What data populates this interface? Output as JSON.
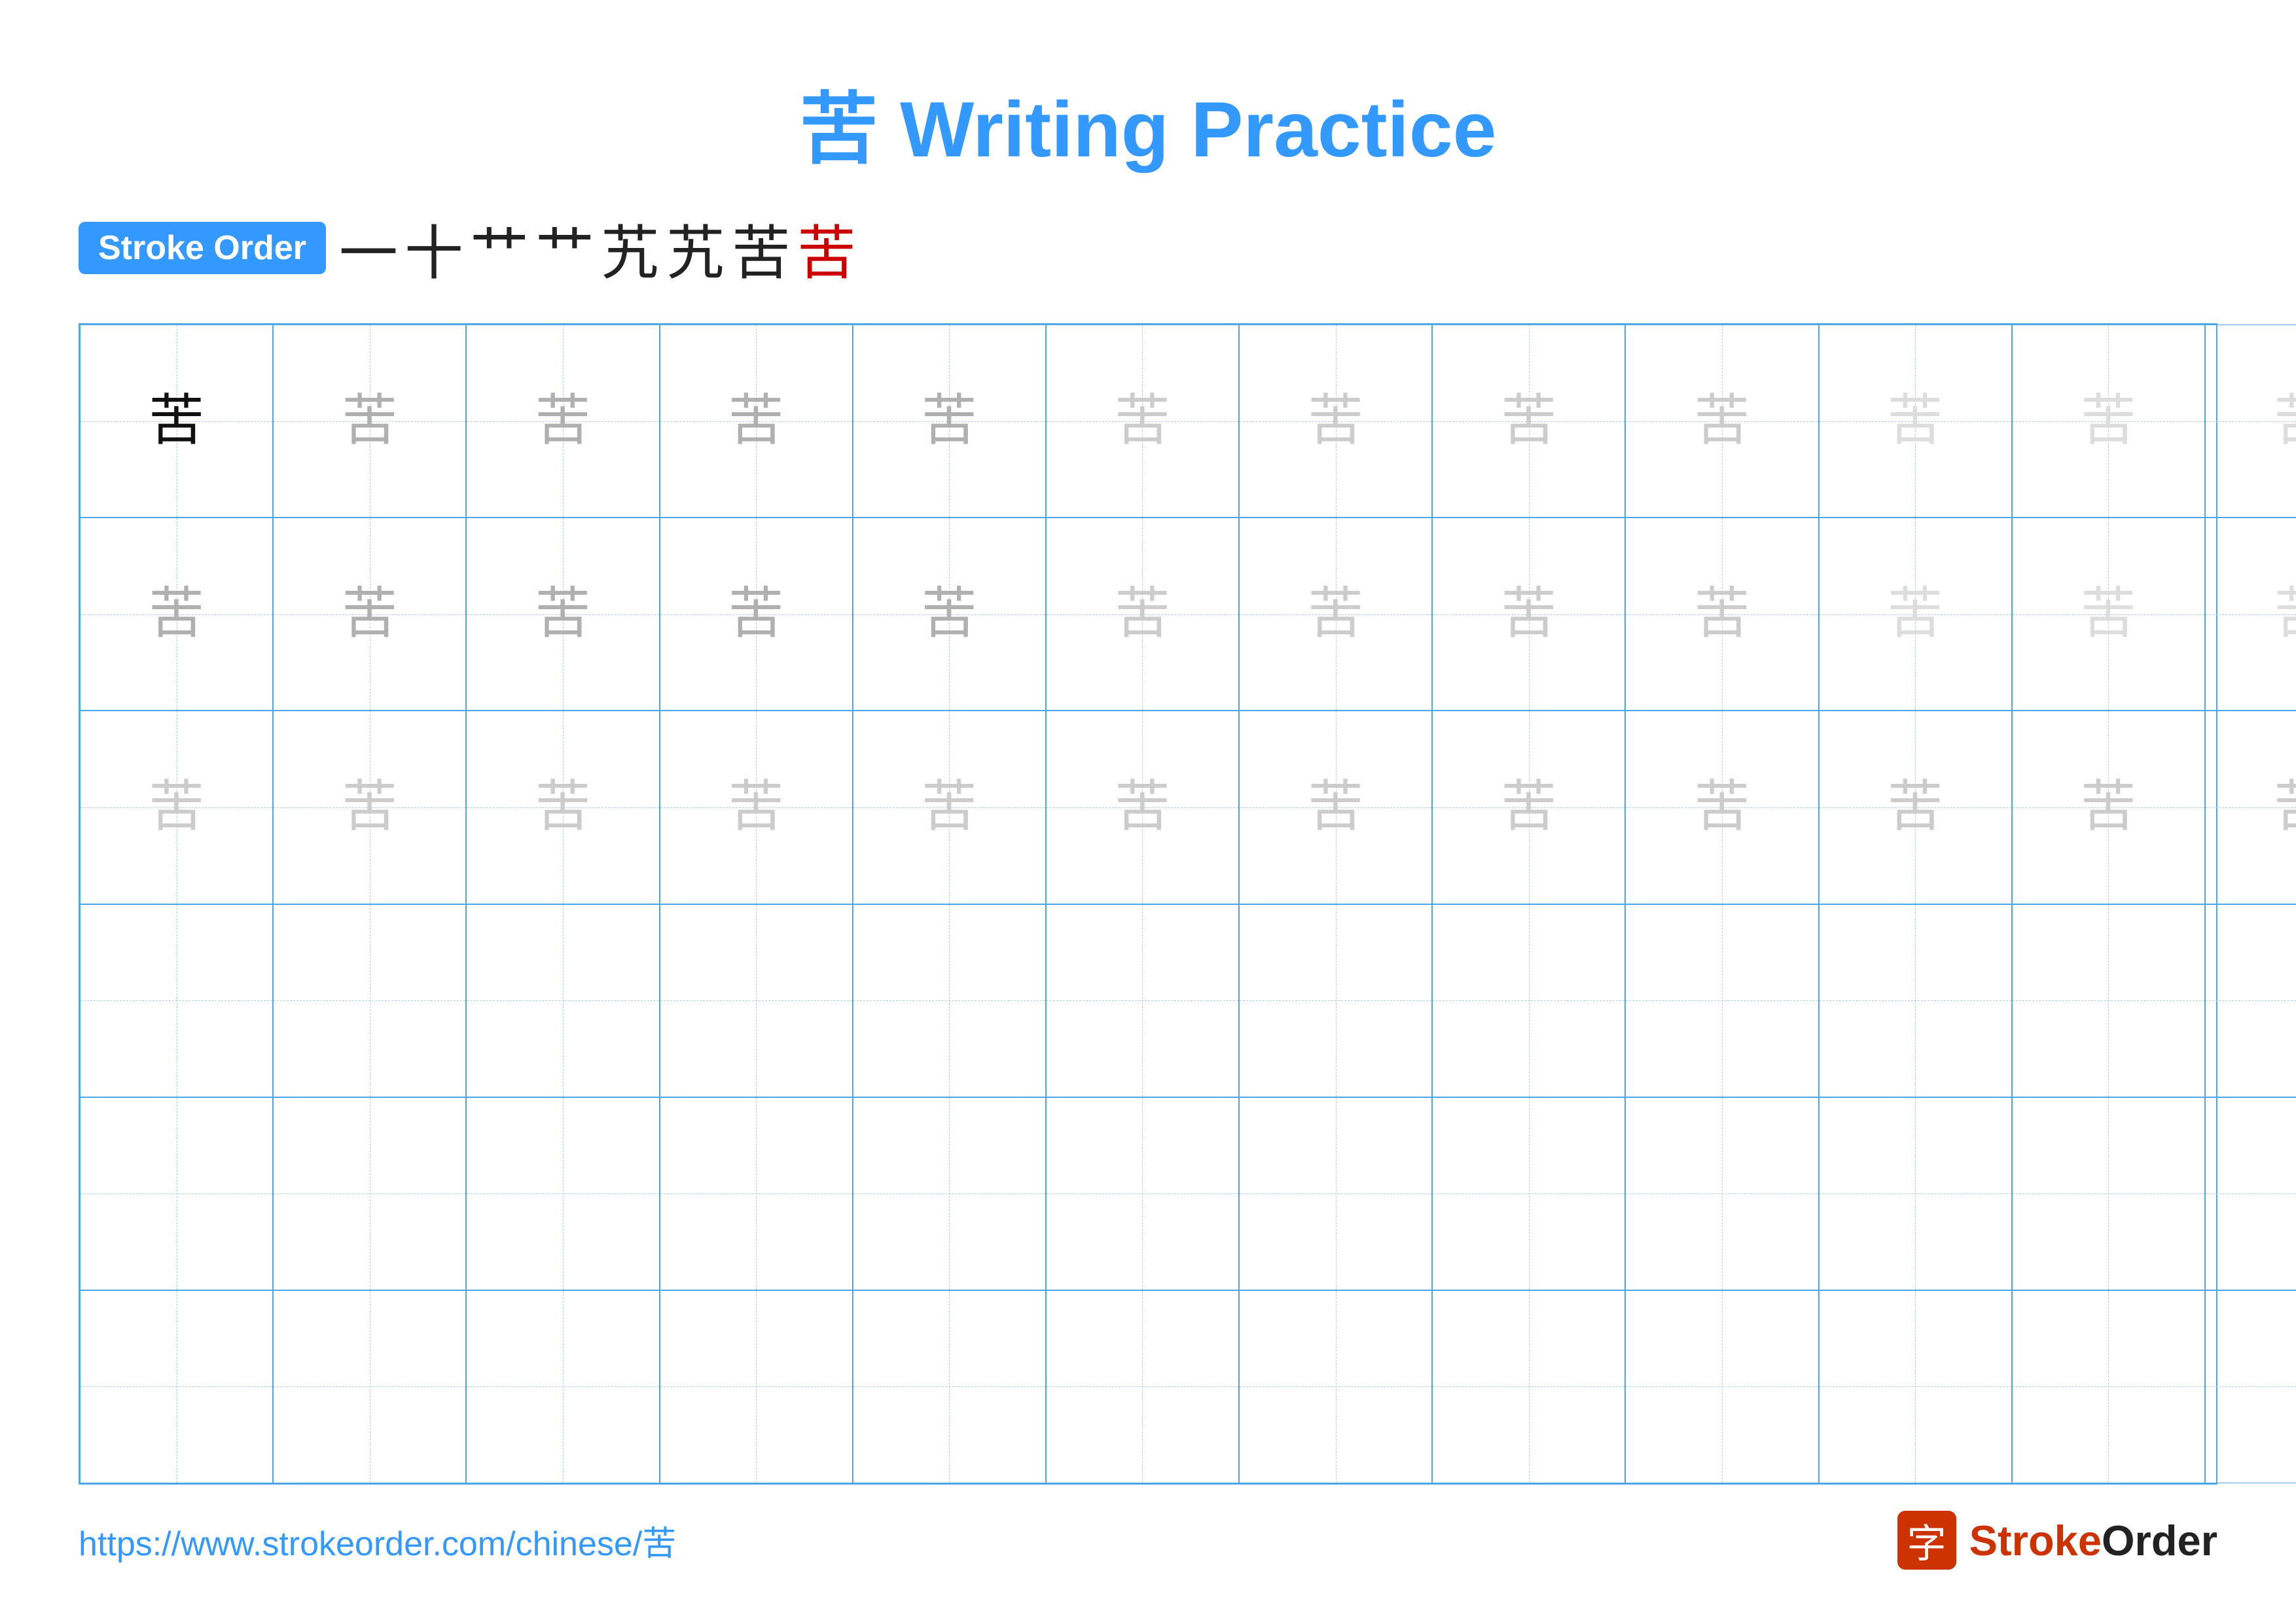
{
  "title": "苦 Writing Practice",
  "stroke_order_badge": "Stroke Order",
  "stroke_sequence": [
    "一",
    "十",
    "艹",
    "艹",
    "艽",
    "艽",
    "苦",
    "苦"
  ],
  "stroke_sequence_colors": [
    "black",
    "black",
    "black",
    "black",
    "black",
    "black",
    "black",
    "red"
  ],
  "character": "苦",
  "grid_rows": 6,
  "grid_cols": 13,
  "footer_url": "https://www.strokeorder.com/chinese/苦",
  "logo_text": "StrokeOrder",
  "logo_char": "字",
  "row_configs": [
    {
      "type": "filled",
      "shades": [
        "black",
        "gray1",
        "gray1",
        "gray1",
        "gray1",
        "gray2",
        "gray2",
        "gray2",
        "gray2",
        "gray3",
        "gray3",
        "gray3",
        "gray3"
      ]
    },
    {
      "type": "filled",
      "shades": [
        "gray1",
        "gray1",
        "gray1",
        "gray1",
        "gray1",
        "gray2",
        "gray2",
        "gray2",
        "gray2",
        "gray3",
        "gray3",
        "gray3",
        "gray3"
      ]
    },
    {
      "type": "filled",
      "shades": [
        "gray2",
        "gray2",
        "gray2",
        "gray2",
        "gray2",
        "gray2",
        "gray2",
        "gray2",
        "gray2",
        "gray2",
        "gray2",
        "gray2",
        "gray2"
      ]
    },
    {
      "type": "empty"
    },
    {
      "type": "empty"
    },
    {
      "type": "empty"
    }
  ]
}
